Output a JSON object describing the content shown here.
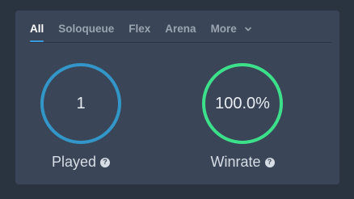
{
  "tabs": [
    {
      "label": "All",
      "active": true
    },
    {
      "label": "Soloqueue",
      "active": false
    },
    {
      "label": "Flex",
      "active": false
    },
    {
      "label": "Arena",
      "active": false
    },
    {
      "label": "More",
      "active": false
    }
  ],
  "stats": {
    "played": {
      "value": "1",
      "label": "Played",
      "ring_color": "#3296c8"
    },
    "winrate": {
      "value": "100.0%",
      "label": "Winrate",
      "ring_color": "#3de08a"
    }
  },
  "icons": {
    "help": "?"
  },
  "colors": {
    "background": "#2a3441",
    "panel": "#3a4657",
    "accent": "#3b9ad9"
  }
}
